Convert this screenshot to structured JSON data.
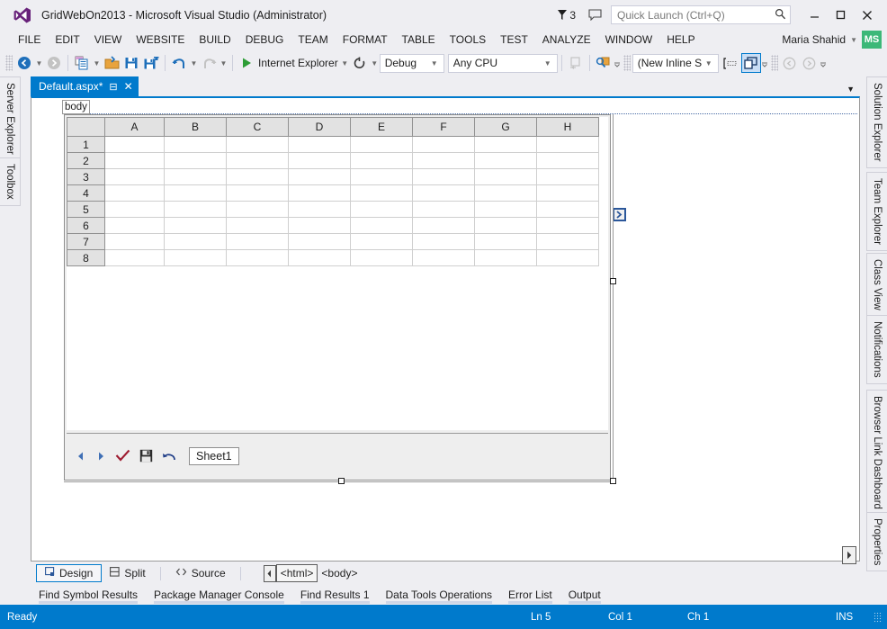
{
  "window": {
    "title": "GridWebOn2013 - Microsoft Visual Studio (Administrator)",
    "logo_icon": "visual-studio-logo",
    "notification_count": "3",
    "notification_icon": "flag-icon",
    "feedback_icon": "feedback-speech-bubble-icon",
    "minimize_icon": "minimize-icon",
    "maximize_icon": "maximize-icon",
    "close_icon": "close-icon",
    "accent_color": "#007acc"
  },
  "search": {
    "placeholder": "Quick Launch (Ctrl+Q)",
    "value": "",
    "icon": "search-icon"
  },
  "menu": {
    "items": [
      {
        "label": "FILE"
      },
      {
        "label": "EDIT"
      },
      {
        "label": "VIEW"
      },
      {
        "label": "WEBSITE"
      },
      {
        "label": "BUILD"
      },
      {
        "label": "DEBUG"
      },
      {
        "label": "TEAM"
      },
      {
        "label": "FORMAT"
      },
      {
        "label": "TABLE"
      },
      {
        "label": "TOOLS"
      },
      {
        "label": "TEST"
      },
      {
        "label": "ANALYZE"
      },
      {
        "label": "WINDOW"
      },
      {
        "label": "HELP"
      }
    ],
    "user": {
      "name": "Maria Shahid",
      "initials": "MS",
      "avatar_color": "#3cb878"
    }
  },
  "toolbar": {
    "navigate_back_icon": "navigate-back-icon",
    "navigate_forward_icon": "navigate-forward-icon",
    "new_item_icon": "new-item-icon",
    "open_file_icon": "open-file-icon",
    "save_icon": "save-icon",
    "save_all_icon": "save-all-icon",
    "undo_icon": "undo-icon",
    "redo_icon": "redo-icon",
    "start_icon": "start-debug-play-icon",
    "start_label": "Internet Explorer",
    "refresh_icon": "refresh-icon",
    "config_value": "Debug",
    "platform_value": "Any CPU",
    "step_icon": "step-into-icon",
    "find_icon": "find-in-files-icon",
    "style_value": "(New Inline Style",
    "style_apply_icon": "style-target-rule-icon",
    "attach_style_icon": "attach-style-sheet-icon",
    "nav_back_icon": "back-arrow-icon",
    "nav_fwd_icon": "forward-arrow-icon"
  },
  "document_tab": {
    "label": "Default.aspx*",
    "pin_icon": "pin-icon",
    "close_icon": "close-icon",
    "overflow_icon": "chevron-down-icon"
  },
  "left_dock": {
    "items": [
      {
        "label": "Server Explorer"
      },
      {
        "label": "Toolbox"
      }
    ]
  },
  "right_dock": {
    "items": [
      {
        "label": "Solution Explorer"
      },
      {
        "label": "Team Explorer"
      },
      {
        "label": "Class View"
      },
      {
        "label": "Notifications"
      },
      {
        "label": "Browser Link Dashboard"
      },
      {
        "label": "Properties"
      }
    ]
  },
  "designer": {
    "body_tag_label": "body",
    "expand_icon": "expand-chevron-icon",
    "gridweb": {
      "columns": [
        "A",
        "B",
        "C",
        "D",
        "E",
        "F",
        "G",
        "H"
      ],
      "rows": [
        "1",
        "2",
        "3",
        "4",
        "5",
        "6",
        "7",
        "8"
      ],
      "sheet_name": "Sheet1",
      "prev_icon": "prev-sheet-arrow-icon",
      "next_icon": "next-sheet-arrow-icon",
      "submit_icon": "check-submit-icon",
      "save_icon": "save-floppy-icon",
      "undo_icon": "undo-arrow-icon"
    }
  },
  "view_selector": {
    "tabs": [
      {
        "label": "Design",
        "icon": "design-view-icon",
        "active": true
      },
      {
        "label": "Split",
        "icon": "split-view-icon",
        "active": false
      },
      {
        "label": "Source",
        "icon": "source-view-icon",
        "active": false
      }
    ],
    "tag_nav": {
      "back_icon": "tag-nav-back-icon",
      "tags": [
        "<html>",
        "<body>"
      ]
    },
    "scroll_right_icon": "scroll-right-arrow-icon"
  },
  "bottom_tabs": {
    "items": [
      {
        "label": "Find Symbol Results"
      },
      {
        "label": "Package Manager Console"
      },
      {
        "label": "Find Results 1"
      },
      {
        "label": "Data Tools Operations"
      },
      {
        "label": "Error List"
      },
      {
        "label": "Output"
      }
    ]
  },
  "status_bar": {
    "message": "Ready",
    "line": "Ln 5",
    "column": "Col 1",
    "character": "Ch 1",
    "insert_mode": "INS",
    "background": "#007acc"
  }
}
